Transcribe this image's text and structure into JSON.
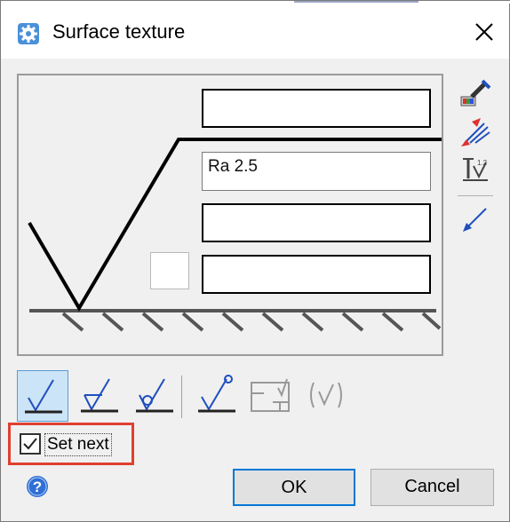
{
  "dialog": {
    "title": "Surface texture"
  },
  "symbol": {
    "field1": "",
    "field2": "Ra 2.5",
    "field3": "",
    "field4": "",
    "small_box": ""
  },
  "side_tools": [
    "brush-icon",
    "arrow-fan-icon",
    "text-style-icon",
    "leader-arrow-icon"
  ],
  "symbol_buttons": [
    "basic-check-icon",
    "machined-check-icon",
    "no-removal-check-icon",
    "all-around-check-icon",
    "frame-icon",
    "parenthesis-check-icon"
  ],
  "set_next": {
    "label": "Set next",
    "checked": true
  },
  "buttons": {
    "ok": "OK",
    "cancel": "Cancel"
  },
  "colors": {
    "accent": "#0078d7",
    "highlight": "#e04030",
    "active_bg": "#cce4f7",
    "icon_blue": "#1f4fbf"
  }
}
